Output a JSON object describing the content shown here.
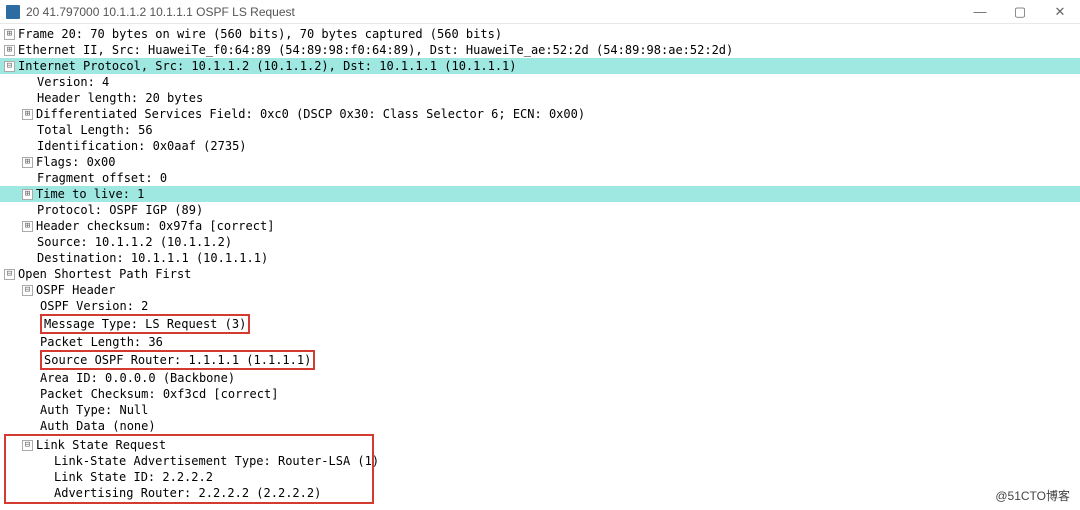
{
  "window": {
    "title": "20 41.797000 10.1.1.2 10.1.1.1 OSPF LS Request",
    "minimize": "—",
    "maximize": "▢",
    "close": "✕"
  },
  "tree": {
    "frame_header": "Frame 20: 70 bytes on wire (560 bits), 70 bytes captured (560 bits)",
    "eth_header": "Ethernet II, Src: HuaweiTe_f0:64:89 (54:89:98:f0:64:89), Dst: HuaweiTe_ae:52:2d (54:89:98:ae:52:2d)",
    "ip_header": "Internet Protocol, Src: 10.1.1.2 (10.1.1.2), Dst: 10.1.1.1 (10.1.1.1)",
    "ip": {
      "version": "Version: 4",
      "hlen": "Header length: 20 bytes",
      "dsfield": "Differentiated Services Field: 0xc0 (DSCP 0x30: Class Selector 6; ECN: 0x00)",
      "tlen": "Total Length: 56",
      "ident": "Identification: 0x0aaf (2735)",
      "flags": "Flags: 0x00",
      "fragoff": "Fragment offset: 0",
      "ttl": "Time to live: 1",
      "proto": "Protocol: OSPF IGP (89)",
      "cksum": "Header checksum: 0x97fa [correct]",
      "src": "Source: 10.1.1.2 (10.1.1.2)",
      "dst": "Destination: 10.1.1.1 (10.1.1.1)"
    },
    "ospf_header": "Open Shortest Path First",
    "ospf": {
      "hdr_label": "OSPF Header",
      "ver": "OSPF Version: 2",
      "msgtype": "Message Type: LS Request (3)",
      "plen": "Packet Length: 36",
      "srcrtr": "Source OSPF Router: 1.1.1.1 (1.1.1.1)",
      "areaid": "Area ID: 0.0.0.0 (Backbone)",
      "pkcksum": "Packet Checksum: 0xf3cd [correct]",
      "authtype": "Auth Type: Null",
      "authdata": "Auth Data (none)"
    },
    "lsr_header": "Link State Request",
    "lsr_toggle": "⊟",
    "lsr": {
      "lsa_type": "Link-State Advertisement Type: Router-LSA (1)",
      "ls_id": "Link State ID: 2.2.2.2",
      "adv_rtr": "Advertising Router: 2.2.2.2 (2.2.2.2)"
    }
  },
  "toggles": {
    "plus": "⊞",
    "minus": "⊟"
  },
  "watermark": "@51CTO博客"
}
